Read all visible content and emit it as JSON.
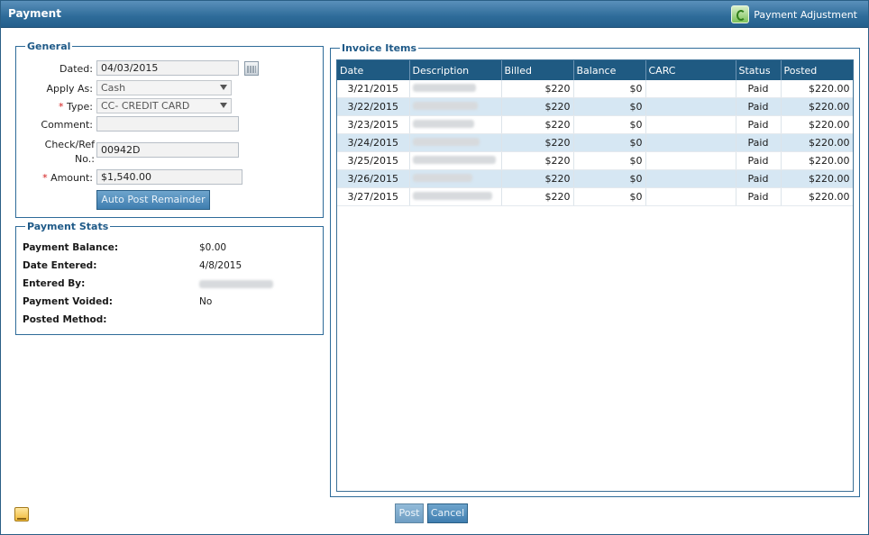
{
  "window": {
    "title": "Payment"
  },
  "header": {
    "adjustment_link": "Payment Adjustment",
    "adjustment_icon": "recycle-icon"
  },
  "general": {
    "legend": "General",
    "dated_label": "Dated:",
    "dated_value": "04/03/2015",
    "apply_as_label": "Apply As:",
    "apply_as_value": "Cash",
    "required_mark": "*",
    "type_label": "Type:",
    "type_value": "CC- CREDIT CARD",
    "comment_label": "Comment:",
    "comment_value": "",
    "check_ref_label": "Check/Ref No.:",
    "check_ref_value": "00942D",
    "amount_label": "Amount:",
    "amount_value": "$1,540.00",
    "auto_post_label": "Auto Post Remainder"
  },
  "stats": {
    "legend": "Payment Stats",
    "rows": [
      {
        "label": "Payment Balance:",
        "value": "$0.00"
      },
      {
        "label": "Date Entered:",
        "value": "4/8/2015"
      },
      {
        "label": "Entered By:",
        "value": ""
      },
      {
        "label": "Payment Voided:",
        "value": "No"
      },
      {
        "label": "Posted Method:",
        "value": ""
      }
    ]
  },
  "invoice": {
    "legend": "Invoice Items",
    "columns": [
      "Date",
      "Description",
      "Billed",
      "Balance",
      "CARC",
      "Status",
      "Posted"
    ],
    "rows": [
      {
        "date": "3/21/2015",
        "description": "",
        "billed": "$220",
        "balance": "$0",
        "carc": "",
        "status": "Paid",
        "posted": "$220.00"
      },
      {
        "date": "3/22/2015",
        "description": "",
        "billed": "$220",
        "balance": "$0",
        "carc": "",
        "status": "Paid",
        "posted": "$220.00"
      },
      {
        "date": "3/23/2015",
        "description": "",
        "billed": "$220",
        "balance": "$0",
        "carc": "",
        "status": "Paid",
        "posted": "$220.00"
      },
      {
        "date": "3/24/2015",
        "description": "",
        "billed": "$220",
        "balance": "$0",
        "carc": "",
        "status": "Paid",
        "posted": "$220.00"
      },
      {
        "date": "3/25/2015",
        "description": "",
        "billed": "$220",
        "balance": "$0",
        "carc": "",
        "status": "Paid",
        "posted": "$220.00"
      },
      {
        "date": "3/26/2015",
        "description": "",
        "billed": "$220",
        "balance": "$0",
        "carc": "",
        "status": "Paid",
        "posted": "$220.00"
      },
      {
        "date": "3/27/2015",
        "description": "",
        "billed": "$220",
        "balance": "$0",
        "carc": "",
        "status": "Paid",
        "posted": "$220.00"
      }
    ]
  },
  "footer": {
    "post_label": "Post",
    "cancel_label": "Cancel",
    "notes_icon": "notes-icon"
  },
  "colors": {
    "title_bar": "#2e6b99",
    "header_row": "#1f5a82",
    "alt_row": "#d6e7f3",
    "button": "#3f7eb0",
    "required": "#d21a1a"
  }
}
